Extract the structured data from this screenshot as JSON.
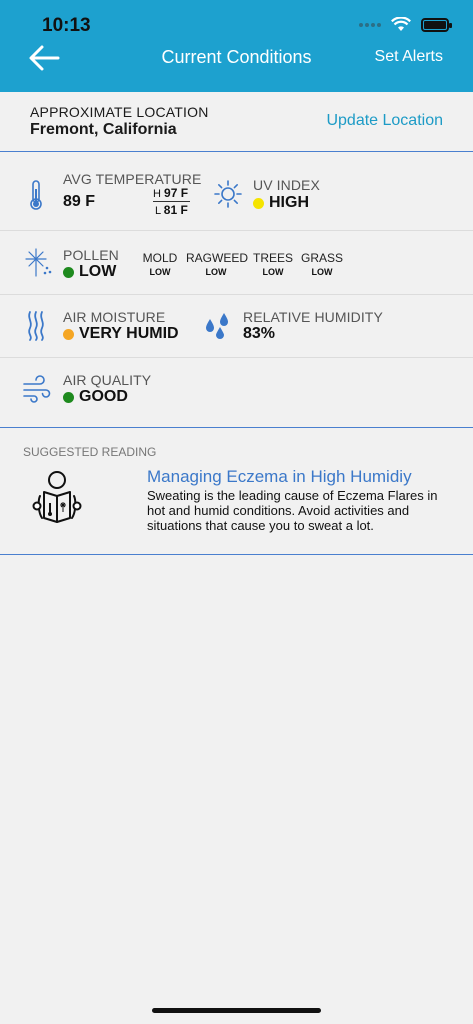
{
  "status_bar": {
    "time": "10:13"
  },
  "header": {
    "title": "Current Conditions",
    "set_alerts": "Set Alerts"
  },
  "location": {
    "label": "APPROXIMATE LOCATION",
    "value": "Fremont, California",
    "update": "Update Location"
  },
  "temperature": {
    "label": "AVG TEMPERATURE",
    "value": "89 F",
    "high_prefix": "H",
    "high": "97 F",
    "low_prefix": "L",
    "low": "81 F"
  },
  "uv": {
    "label": "UV INDEX",
    "value": "HIGH",
    "dot_color": "#f5e400"
  },
  "pollen": {
    "label": "POLLEN",
    "value": "LOW",
    "dot_color": "#1e8a1e",
    "categories": [
      {
        "name": "MOLD",
        "level": "LOW"
      },
      {
        "name": "RAGWEED",
        "level": "LOW"
      },
      {
        "name": "TREES",
        "level": "LOW"
      },
      {
        "name": "GRASS",
        "level": "LOW"
      }
    ]
  },
  "air_moisture": {
    "label": "AIR MOISTURE",
    "value": "VERY HUMID",
    "dot_color": "#f5a623"
  },
  "humidity": {
    "label": "RELATIVE HUMIDITY",
    "value": "83%"
  },
  "air_quality": {
    "label": "AIR QUALITY",
    "value": "GOOD",
    "dot_color": "#1e8a1e"
  },
  "reading": {
    "section_label": "SUGGESTED READING",
    "title": "Managing Eczema in High Humidiy",
    "body": "Sweating is the leading cause of Eczema Flares in hot and humid conditions. Avoid activities and situations that cause you to sweat a lot."
  },
  "icons": {
    "back": "back-arrow-icon",
    "thermometer": "thermometer-icon",
    "sun": "sun-icon",
    "pollen": "dandelion-icon",
    "moisture": "wavy-lines-icon",
    "humidity": "water-drops-icon",
    "air": "wind-icon",
    "reading": "person-reading-icon"
  },
  "colors": {
    "header": "#1da1cf",
    "link": "#1d9bc6",
    "article_title": "#3b78c9",
    "icon_blue": "#3b78c9"
  }
}
